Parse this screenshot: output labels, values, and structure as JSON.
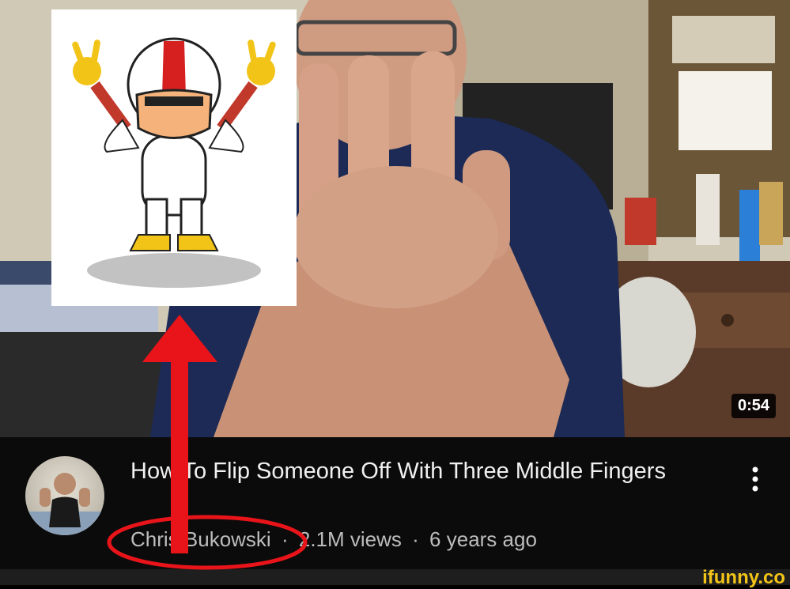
{
  "video": {
    "duration": "0:54",
    "title": "How To Flip Someone Off With Three Middle Fingers",
    "more_icon": "vertical-ellipsis-icon"
  },
  "channel": {
    "name": "Chris Bukowski",
    "views": "2.1M views",
    "separator": "·",
    "age": "6 years ago"
  },
  "watermark": "ifunny.co",
  "colors": {
    "annotation_red": "#e8141a",
    "watermark_yellow": "#f2c418"
  }
}
